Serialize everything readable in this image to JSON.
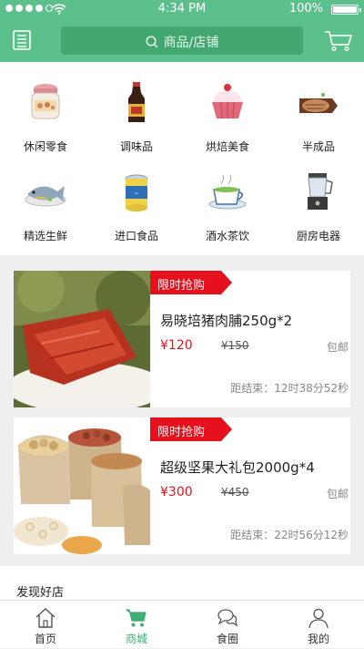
{
  "status_bar": {
    "time": "4:34 PM",
    "battery": "100%"
  },
  "header": {
    "search_placeholder": "商品/店铺"
  },
  "categories": [
    {
      "label": "休闲零食",
      "icon": "snack-jar-icon"
    },
    {
      "label": "调味品",
      "icon": "soy-sauce-bottle-icon"
    },
    {
      "label": "烘焙美食",
      "icon": "cupcake-icon"
    },
    {
      "label": "半成品",
      "icon": "steak-icon"
    },
    {
      "label": "精选生鲜",
      "icon": "fish-icon"
    },
    {
      "label": "进口食品",
      "icon": "canned-food-icon"
    },
    {
      "label": "酒水茶饮",
      "icon": "tea-cup-icon"
    },
    {
      "label": "厨房电器",
      "icon": "blender-icon"
    }
  ],
  "flash_sales": [
    {
      "tag": "限时抢购",
      "title": "易晓培猪肉脯250g*2",
      "price": "¥120",
      "old_price": "¥150",
      "shipping": "包邮",
      "countdown": "距结束：12时38分52秒"
    },
    {
      "tag": "限时抢购",
      "title": "超级坚果大礼包2000g*4",
      "price": "¥300",
      "old_price": "¥450",
      "shipping": "包邮",
      "countdown": "距结束：22时56分12秒"
    }
  ],
  "section": {
    "title": "发现好店"
  },
  "tabbar": [
    {
      "label": "首页",
      "icon": "home-icon",
      "active": false
    },
    {
      "label": "商城",
      "icon": "shopping-cart-icon",
      "active": true
    },
    {
      "label": "食圈",
      "icon": "chat-bubble-icon",
      "active": false
    },
    {
      "label": "我的",
      "icon": "user-icon",
      "active": false
    }
  ],
  "colors": {
    "brand": "#5cc08c",
    "search_bg": "#43a770",
    "price": "#e6111d",
    "tag": "#e6111d",
    "active_tab": "#3fae73"
  }
}
